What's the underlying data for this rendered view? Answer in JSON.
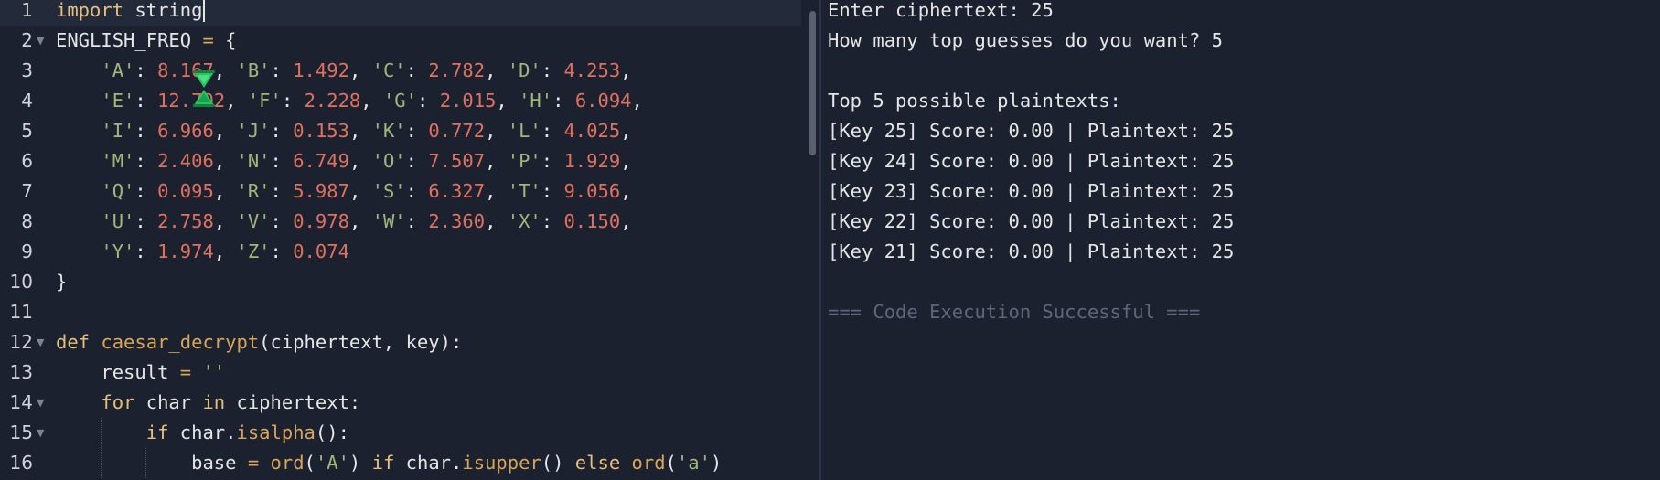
{
  "editor": {
    "line_numbers": [
      "1",
      "2",
      "3",
      "4",
      "5",
      "6",
      "7",
      "8",
      "9",
      "10",
      "11",
      "12",
      "13",
      "14",
      "15",
      "16"
    ],
    "line1": {
      "kw": "import",
      "rest": " string"
    },
    "line2": {
      "name": "ENGLISH_FREQ",
      "eq": " = ",
      "brace": "{"
    },
    "freq_rows": [
      [
        [
          "'A'",
          "8.167"
        ],
        [
          "'B'",
          "1.492"
        ],
        [
          "'C'",
          "2.782"
        ],
        [
          "'D'",
          "4.253"
        ]
      ],
      [
        [
          "'E'",
          "12.702"
        ],
        [
          "'F'",
          "2.228"
        ],
        [
          "'G'",
          "2.015"
        ],
        [
          "'H'",
          "6.094"
        ]
      ],
      [
        [
          "'I'",
          "6.966"
        ],
        [
          "'J'",
          "0.153"
        ],
        [
          "'K'",
          "0.772"
        ],
        [
          "'L'",
          "4.025"
        ]
      ],
      [
        [
          "'M'",
          "2.406"
        ],
        [
          "'N'",
          "6.749"
        ],
        [
          "'O'",
          "7.507"
        ],
        [
          "'P'",
          "1.929"
        ]
      ],
      [
        [
          "'Q'",
          "0.095"
        ],
        [
          "'R'",
          "5.987"
        ],
        [
          "'S'",
          "6.327"
        ],
        [
          "'T'",
          "9.056"
        ]
      ],
      [
        [
          "'U'",
          "2.758"
        ],
        [
          "'V'",
          "0.978"
        ],
        [
          "'W'",
          "2.360"
        ],
        [
          "'X'",
          "0.150"
        ]
      ],
      [
        [
          "'Y'",
          "1.974"
        ],
        [
          "'Z'",
          "0.074"
        ]
      ]
    ],
    "line10": "}",
    "line12": {
      "kw": "def",
      "fn": "caesar_decrypt",
      "params": "(ciphertext, key):"
    },
    "line13": {
      "var": "result",
      "eq": " = ",
      "str": "''"
    },
    "line14": {
      "kw1": "for",
      "var": " char ",
      "kw2": "in",
      "rest": " ciphertext:"
    },
    "line15": {
      "kw": "if",
      "obj": " char.",
      "fn": "isalpha",
      "rest": "():"
    },
    "line16": {
      "var": "base",
      "eq": " = ",
      "fn1": "ord",
      "p1": "(",
      "s1": "'A'",
      "p2": ") ",
      "kw1": "if",
      "obj": " char.",
      "fn2": "isupper",
      "p3": "() ",
      "kw2": "else",
      "sp": " ",
      "fn3": "ord",
      "p4": "(",
      "s2": "'a'",
      "p5": ")"
    }
  },
  "output": {
    "lines": [
      "Enter ciphertext: 25",
      "How many top guesses do you want? 5",
      "",
      "Top 5 possible plaintexts:",
      "[Key 25] Score: 0.00 | Plaintext: 25",
      "[Key 24] Score: 0.00 | Plaintext: 25",
      "[Key 23] Score: 0.00 | Plaintext: 25",
      "[Key 22] Score: 0.00 | Plaintext: 25",
      "[Key 21] Score: 0.00 | Plaintext: 25",
      "",
      "=== Code Execution Successful ==="
    ]
  },
  "icons": {
    "loading": "hourglass-icon",
    "fold": "chevron-down-icon"
  },
  "colors": {
    "background": "#1c2130",
    "keyword": "#e5c07b",
    "string": "#a0b87a",
    "number": "#e0715e",
    "text": "#e6e6e6",
    "muted": "#5f6677"
  }
}
